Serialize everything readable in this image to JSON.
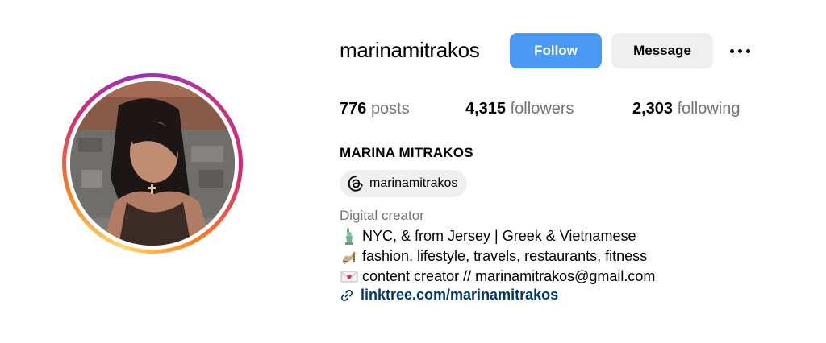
{
  "profile": {
    "username": "marinamitrakos",
    "full_name": "MARINA MITRAKOS",
    "category": "Digital creator"
  },
  "actions": {
    "follow_label": "Follow",
    "message_label": "Message",
    "more_icon": "more-options-icon"
  },
  "stats": {
    "posts_count": "776",
    "posts_label": "posts",
    "followers_count": "4,315",
    "followers_label": "followers",
    "following_count": "2,303",
    "following_label": "following"
  },
  "threads": {
    "handle": "marinamitrakos",
    "icon": "threads-icon"
  },
  "bio": {
    "line1": "NYC, & from Jersey | Greek & Vietnamese",
    "line2": "fashion, lifestyle, travels, restaurants, fitness",
    "line3": "content creator // marinamitrakos@gmail.com",
    "line1_icon": "statue-of-liberty-emoji",
    "line2_icon": "high-heel-emoji",
    "line3_icon": "love-letter-emoji"
  },
  "link": {
    "text": "linktree.com/marinamitrakos",
    "icon": "link-icon"
  },
  "colors": {
    "follow_button": "#4a9af5",
    "secondary_button": "#efefef",
    "muted_text": "#737373",
    "link_text": "#00376b"
  }
}
